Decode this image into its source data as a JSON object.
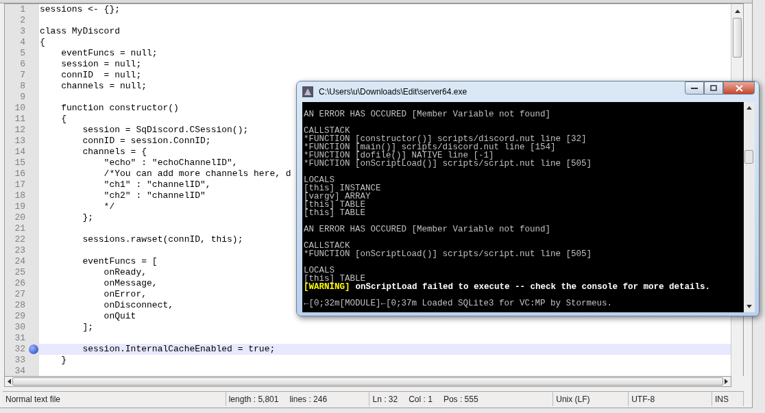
{
  "editor": {
    "lines": [
      {
        "number": "1",
        "code": "sessions <- {};",
        "current": false,
        "bookmark": false
      },
      {
        "number": "2",
        "current": false,
        "bookmark": false
      },
      {
        "number": "3",
        "code": "class MyDiscord",
        "current": false,
        "bookmark": false
      },
      {
        "number": "4",
        "code": "{",
        "current": false,
        "bookmark": false
      },
      {
        "number": "5",
        "code": "    eventFuncs = null;",
        "current": false,
        "bookmark": false
      },
      {
        "number": "6",
        "code": "    session = null;",
        "current": false,
        "bookmark": false
      },
      {
        "number": "7",
        "code": "    connID  = null;",
        "current": false,
        "bookmark": false
      },
      {
        "number": "8",
        "code": "    channels = null;",
        "current": false,
        "bookmark": false
      },
      {
        "number": "9",
        "current": false,
        "bookmark": false
      },
      {
        "number": "10",
        "code": "    function constructor()",
        "current": false,
        "bookmark": false
      },
      {
        "number": "11",
        "code": "    {",
        "current": false,
        "bookmark": false
      },
      {
        "number": "12",
        "code": "        session = SqDiscord.CSession();",
        "current": false,
        "bookmark": false
      },
      {
        "number": "13",
        "code": "        connID = session.ConnID;",
        "current": false,
        "bookmark": false
      },
      {
        "number": "14",
        "code": "        channels = {",
        "current": false,
        "bookmark": false
      },
      {
        "number": "15",
        "code": "            \"echo\" : \"echoChannelID\",",
        "current": false,
        "bookmark": false
      },
      {
        "number": "16",
        "code": "            /*You can add more channels here, d",
        "current": false,
        "bookmark": false
      },
      {
        "number": "17",
        "code": "            \"ch1\" : \"channelID\",",
        "current": false,
        "bookmark": false
      },
      {
        "number": "18",
        "code": "            \"ch2\" : \"channelID\"",
        "current": false,
        "bookmark": false
      },
      {
        "number": "19",
        "code": "            */",
        "current": false,
        "bookmark": false
      },
      {
        "number": "20",
        "code": "        };",
        "current": false,
        "bookmark": false
      },
      {
        "number": "21",
        "current": false,
        "bookmark": false
      },
      {
        "number": "22",
        "code": "        sessions.rawset(connID, this);",
        "current": false,
        "bookmark": false
      },
      {
        "number": "23",
        "current": false,
        "bookmark": false
      },
      {
        "number": "24",
        "code": "        eventFuncs = [",
        "current": false,
        "bookmark": false
      },
      {
        "number": "25",
        "code": "            onReady,",
        "current": false,
        "bookmark": false
      },
      {
        "number": "26",
        "code": "            onMessage,",
        "current": false,
        "bookmark": false
      },
      {
        "number": "27",
        "code": "            onError,",
        "current": false,
        "bookmark": false
      },
      {
        "number": "28",
        "code": "            onDisconnect,",
        "current": false,
        "bookmark": false
      },
      {
        "number": "29",
        "code": "            onQuit",
        "current": false,
        "bookmark": false
      },
      {
        "number": "30",
        "code": "        ];",
        "current": false,
        "bookmark": false
      },
      {
        "number": "31",
        "current": false,
        "bookmark": false
      },
      {
        "number": "32",
        "code": "        session.InternalCacheEnabled = true;",
        "current": true,
        "bookmark": true
      },
      {
        "number": "33",
        "code": "    }",
        "current": false,
        "bookmark": false
      },
      {
        "number": "34",
        "current": false,
        "bookmark": false
      }
    ]
  },
  "status_bar": [
    {
      "texts": [
        "Normal text file"
      ]
    },
    {
      "texts": [
        "length : 5,801",
        "lines : 246"
      ]
    },
    {
      "texts": [
        "Ln : 32",
        "Col : 1",
        "Pos : 555"
      ]
    },
    {
      "texts": [
        "Unix (LF)"
      ]
    },
    {
      "texts": [
        "UTF-8"
      ]
    },
    {
      "texts": [
        "INS"
      ]
    }
  ],
  "console": {
    "title": "C:\\Users\\u\\Downloads\\Edit\\server64.exe",
    "lines": [
      {
        "kind": "blank"
      },
      {
        "kind": "text",
        "text": "AN ERROR HAS OCCURED [Member Variable not found]"
      },
      {
        "kind": "blank"
      },
      {
        "kind": "text",
        "text": "CALLSTACK"
      },
      {
        "kind": "text",
        "text": "*FUNCTION [constructor()] scripts/discord.nut line [32]"
      },
      {
        "kind": "text",
        "text": "*FUNCTION [main()] scripts/discord.nut line [154]"
      },
      {
        "kind": "text",
        "text": "*FUNCTION [dofile()] NATIVE line [-1]"
      },
      {
        "kind": "text",
        "text": "*FUNCTION [onScriptLoad()] scripts/script.nut line [505]"
      },
      {
        "kind": "blank"
      },
      {
        "kind": "text",
        "text": "LOCALS"
      },
      {
        "kind": "text",
        "text": "[this] INSTANCE"
      },
      {
        "kind": "text",
        "text": "[vargv] ARRAY"
      },
      {
        "kind": "text",
        "text": "[this] TABLE"
      },
      {
        "kind": "text",
        "text": "[this] TABLE"
      },
      {
        "kind": "blank"
      },
      {
        "kind": "text",
        "text": "AN ERROR HAS OCCURED [Member Variable not found]"
      },
      {
        "kind": "blank"
      },
      {
        "kind": "text",
        "text": "CALLSTACK"
      },
      {
        "kind": "text",
        "text": "*FUNCTION [onScriptLoad()] scripts/script.nut line [505]"
      },
      {
        "kind": "blank"
      },
      {
        "kind": "text",
        "text": "LOCALS"
      },
      {
        "kind": "text",
        "text": "[this] TABLE"
      },
      {
        "kind": "warning",
        "tag": "[WARNING]",
        "text": "onScriptLoad failed to execute -- check the console for more details."
      },
      {
        "kind": "blank"
      },
      {
        "kind": "text",
        "text": "←[0;32m[MODULE]←[0;37m Loaded SQLite3 for VC:MP by Stormeus."
      }
    ]
  }
}
